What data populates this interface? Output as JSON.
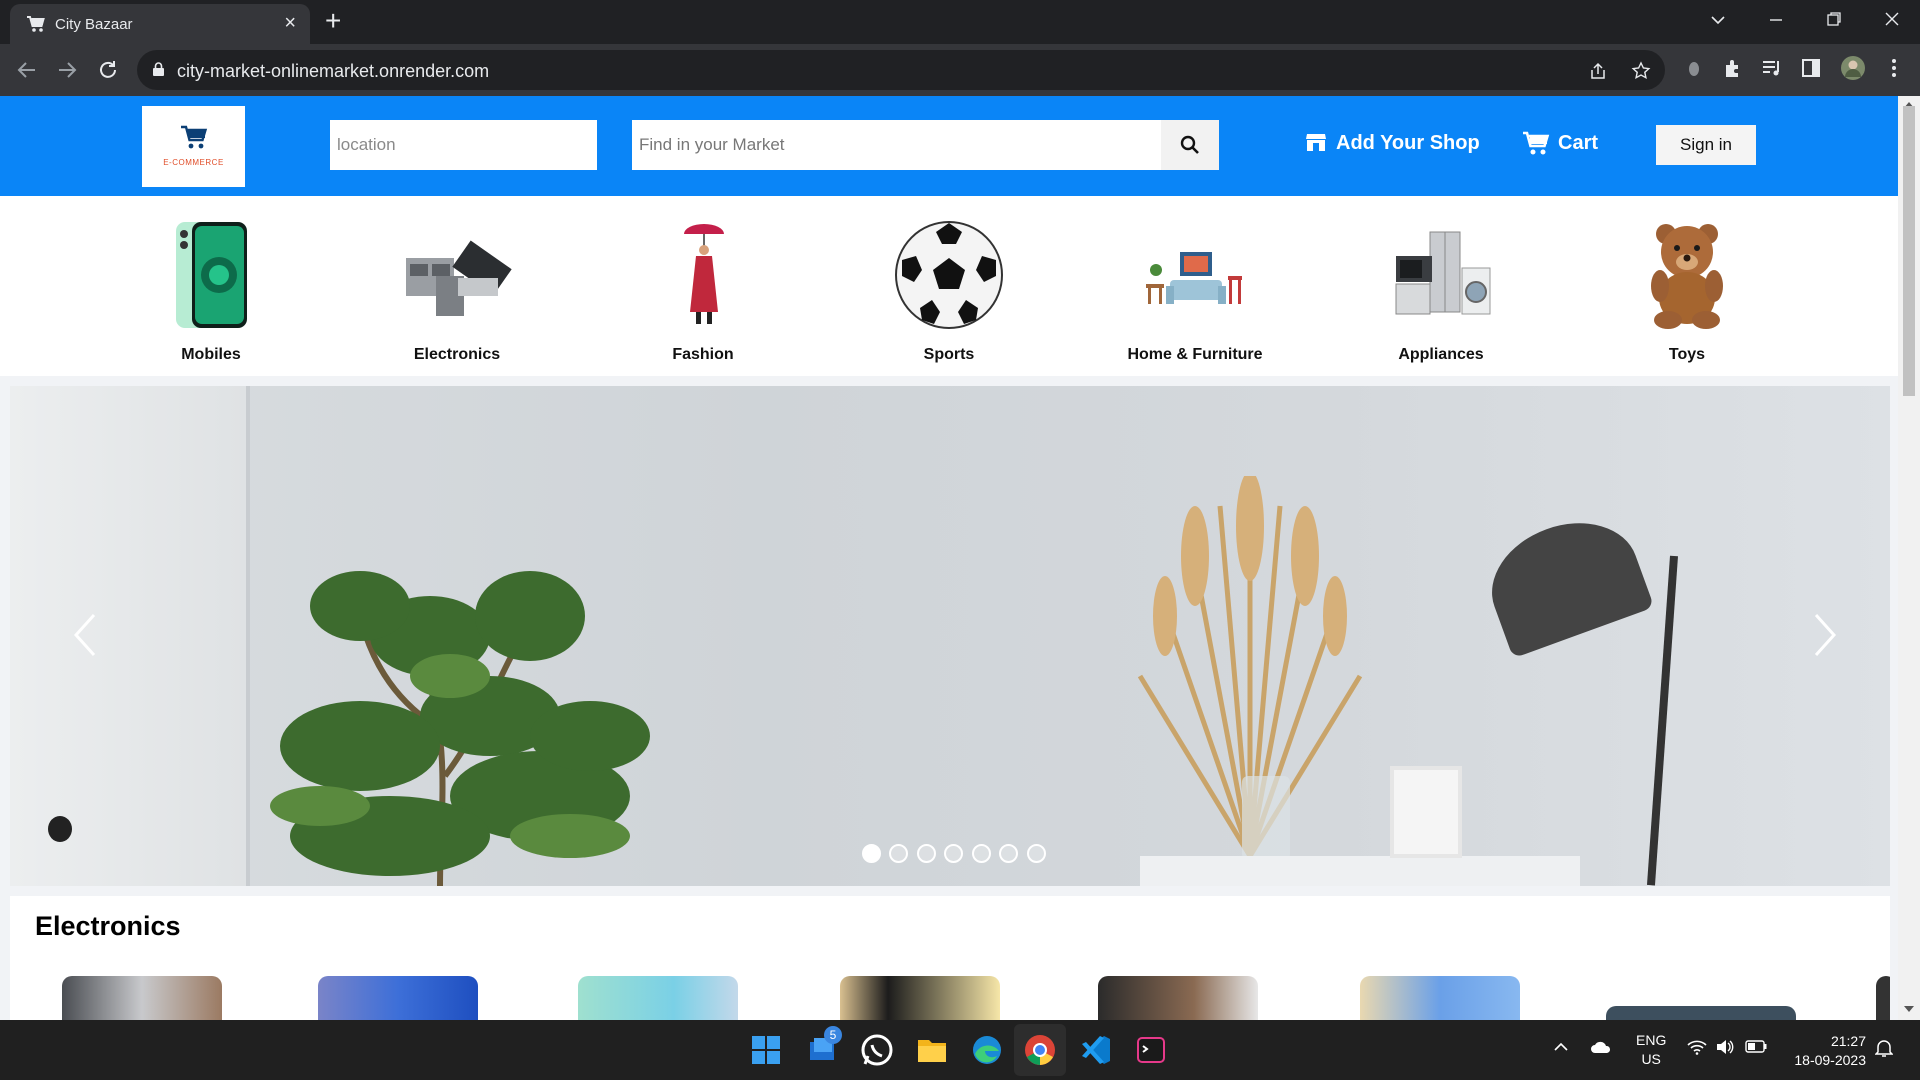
{
  "browser": {
    "tab_title": "City Bazaar",
    "tab_close": "×",
    "new_tab": "+",
    "url": "city-market-onlinemarket.onrender.com"
  },
  "header": {
    "logo_text": "E-COMMERCE",
    "location_placeholder": "location",
    "search_placeholder": "Find in your Market",
    "add_shop_label": "Add Your Shop",
    "cart_label": "Cart",
    "signin_label": "Sign in",
    "brand_color": "#0a85f7"
  },
  "categories": [
    {
      "label": "Mobiles",
      "icon": "phone-icon"
    },
    {
      "label": "Electronics",
      "icon": "electronics-icon"
    },
    {
      "label": "Fashion",
      "icon": "fashion-icon"
    },
    {
      "label": "Sports",
      "icon": "soccer-ball-icon"
    },
    {
      "label": "Home & Furniture",
      "icon": "furniture-icon"
    },
    {
      "label": "Appliances",
      "icon": "appliances-icon"
    },
    {
      "label": "Toys",
      "icon": "teddy-bear-icon"
    }
  ],
  "carousel": {
    "slide_count": 7,
    "active_index": 0
  },
  "section": {
    "title": "Electronics"
  },
  "taskbar": {
    "mail_badge": "5",
    "lang_line1": "ENG",
    "lang_line2": "US",
    "time": "21:27",
    "date": "18-09-2023"
  }
}
